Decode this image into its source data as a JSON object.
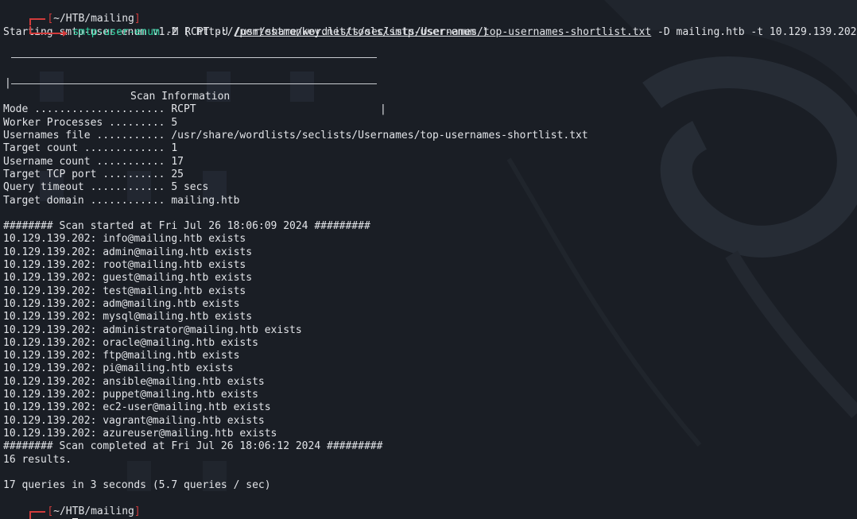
{
  "prompt1": {
    "dir": "~/HTB/mailing",
    "command": "smtp-user-enum",
    "args_before_path": " -M RCPT -U ",
    "wordlist_path": "/usr/share/wordlists/seclists/Usernames/top-usernames-shortlist.txt",
    "args_after_path": " -D mailing.htb -t 10.129.139.202"
  },
  "banner": "Starting smtp-user-enum v1.2 ( http://pentestmonkey.net/tools/smtp-user-enum )",
  "box_title": "Scan Information",
  "scan_info": [
    {
      "label": "Mode ..................... ",
      "value": "RCPT"
    },
    {
      "label": "Worker Processes ......... ",
      "value": "5"
    },
    {
      "label": "Usernames file ........... ",
      "value": "/usr/share/wordlists/seclists/Usernames/top-usernames-shortlist.txt"
    },
    {
      "label": "Target count ............. ",
      "value": "1"
    },
    {
      "label": "Username count ........... ",
      "value": "17"
    },
    {
      "label": "Target TCP port .......... ",
      "value": "25"
    },
    {
      "label": "Query timeout ............ ",
      "value": "5 secs"
    },
    {
      "label": "Target domain ............ ",
      "value": "mailing.htb"
    }
  ],
  "scan_started": "######## Scan started at Fri Jul 26 18:06:09 2024 #########",
  "results": [
    "10.129.139.202: info@mailing.htb exists",
    "10.129.139.202: admin@mailing.htb exists",
    "10.129.139.202: root@mailing.htb exists",
    "10.129.139.202: guest@mailing.htb exists",
    "10.129.139.202: test@mailing.htb exists",
    "10.129.139.202: adm@mailing.htb exists",
    "10.129.139.202: mysql@mailing.htb exists",
    "10.129.139.202: administrator@mailing.htb exists",
    "10.129.139.202: oracle@mailing.htb exists",
    "10.129.139.202: ftp@mailing.htb exists",
    "10.129.139.202: pi@mailing.htb exists",
    "10.129.139.202: ansible@mailing.htb exists",
    "10.129.139.202: puppet@mailing.htb exists",
    "10.129.139.202: ec2-user@mailing.htb exists",
    "10.129.139.202: vagrant@mailing.htb exists",
    "10.129.139.202: azureuser@mailing.htb exists"
  ],
  "scan_completed": "######## Scan completed at Fri Jul 26 18:06:12 2024 #########",
  "results_count": "16 results.",
  "summary": "17 queries in 3 seconds (5.7 queries / sec)",
  "prompt2": {
    "dir": "~/HTB/mailing"
  },
  "colors": {
    "background": "#1a1e25",
    "prompt_red": "#d13b3b",
    "command_green": "#2fd1a0",
    "text": "#e2e4e8"
  }
}
